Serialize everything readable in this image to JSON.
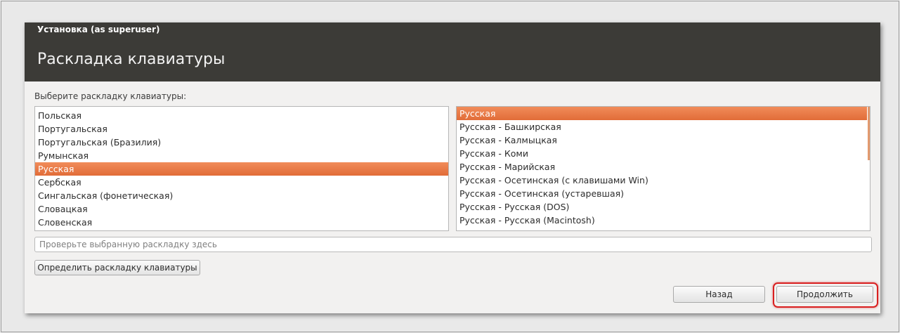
{
  "window": {
    "title": "Установка (as superuser)",
    "page_title": "Раскладка клавиатуры"
  },
  "prompt": "Выберите раскладку клавиатуры:",
  "layouts": {
    "items": [
      {
        "label": "Польская",
        "selected": false
      },
      {
        "label": "Португальская",
        "selected": false
      },
      {
        "label": "Португальская (Бразилия)",
        "selected": false
      },
      {
        "label": "Румынская",
        "selected": false
      },
      {
        "label": "Русская",
        "selected": true
      },
      {
        "label": "Сербская",
        "selected": false
      },
      {
        "label": "Сингальская (фонетическая)",
        "selected": false
      },
      {
        "label": "Словацкая",
        "selected": false
      },
      {
        "label": "Словенская",
        "selected": false
      }
    ]
  },
  "variants": {
    "items": [
      {
        "label": "Русская",
        "selected": true
      },
      {
        "label": "Русская - Башкирская",
        "selected": false
      },
      {
        "label": "Русская - Калмыцкая",
        "selected": false
      },
      {
        "label": "Русская - Коми",
        "selected": false
      },
      {
        "label": "Русская - Марийская",
        "selected": false
      },
      {
        "label": "Русская - Осетинская (с клавишами Win)",
        "selected": false
      },
      {
        "label": "Русская - Осетинская (устаревшая)",
        "selected": false
      },
      {
        "label": "Русская - Русская (DOS)",
        "selected": false
      },
      {
        "label": "Русская - Русская (Macintosh)",
        "selected": false
      }
    ]
  },
  "test_field": {
    "placeholder": "Проверьте выбранную раскладку здесь",
    "value": ""
  },
  "buttons": {
    "detect": "Определить раскладку клавиатуры",
    "back": "Назад",
    "continue": "Продолжить"
  },
  "colors": {
    "header_bg": "#3c3b37",
    "selection": "#e9753f",
    "highlight_ring": "#d92020"
  }
}
